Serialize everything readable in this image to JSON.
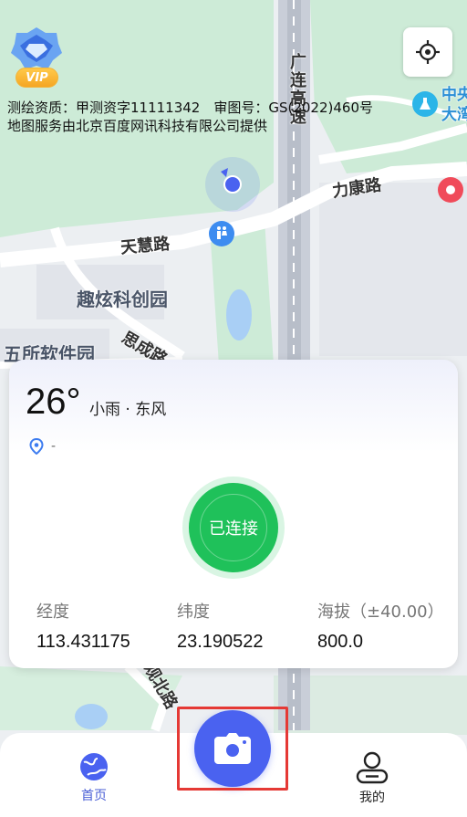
{
  "map": {
    "labels": {
      "road_guanglian": "广连高速",
      "road_likang": "力康路",
      "road_tianhui": "天慧路",
      "road_sicheng": "思成路",
      "road_guanbei": "观北路",
      "park_quxuan": "趣炫科创园",
      "park_wusuo": "五所软件园",
      "poi_partial": "中央大湾"
    },
    "info": {
      "survey_line": "测绘资质：甲测资字11111342　审图号：GS(2022)460号",
      "provider_line": "地图服务由北京百度网讯科技有限公司提供"
    }
  },
  "vip": {
    "label": "VIP"
  },
  "weather": {
    "temperature": "26°",
    "description": "小雨 · 东风",
    "location": "-"
  },
  "connection": {
    "status_label": "已连接"
  },
  "stats": {
    "longitude": {
      "label": "经度",
      "value": "113.431175"
    },
    "latitude": {
      "label": "纬度",
      "value": "23.190522"
    },
    "altitude": {
      "label": "海拔（±40.00）",
      "value": "800.0"
    }
  },
  "nav": {
    "home_label": "首页",
    "mine_label": "我的"
  },
  "icons": {
    "vip": "diamond-vip-icon",
    "locate": "crosshair-icon",
    "location_pin": "location-pin-icon",
    "camera": "camera-icon",
    "home": "globe-icon",
    "mine": "user-icon",
    "toilet": "toilet-icon",
    "lab": "flask-icon",
    "marker": "map-marker-icon"
  },
  "colors": {
    "primary": "#4a62f0",
    "connected": "#1fc15a",
    "highlight": "#e53935",
    "vip_gold": "#f5a623"
  }
}
